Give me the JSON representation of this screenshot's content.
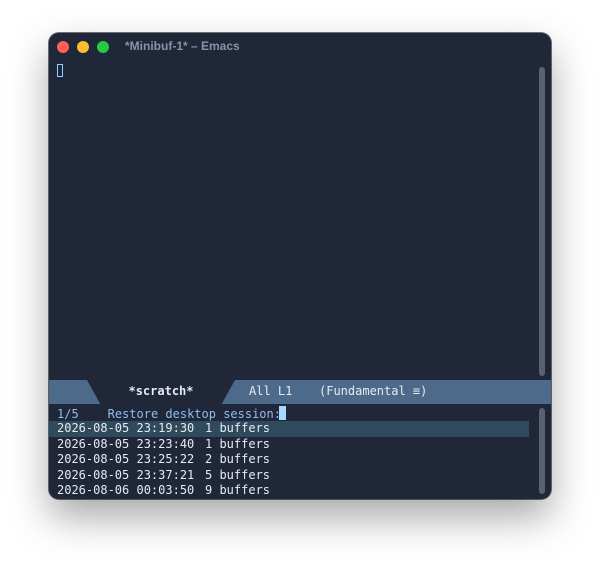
{
  "window": {
    "title": "*Minibuf-1* – Emacs"
  },
  "modeline": {
    "buffer_name": "*scratch*",
    "position": "All L1",
    "mode": "(Fundamental ≡)"
  },
  "minibuffer": {
    "counter": "1/5",
    "prompt": "Restore desktop session:",
    "candidates": [
      {
        "datetime": "2026-08-05 23:19:30",
        "buffers": "1 buffers"
      },
      {
        "datetime": "2026-08-05 23:23:40",
        "buffers": "1 buffers"
      },
      {
        "datetime": "2026-08-05 23:25:22",
        "buffers": "2 buffers"
      },
      {
        "datetime": "2026-08-05 23:37:21",
        "buffers": "5 buffers"
      },
      {
        "datetime": "2026-08-06 00:03:50",
        "buffers": "9 buffers"
      }
    ]
  },
  "colors": {
    "background": "#1f2738",
    "modeline": "#4d6a8a",
    "selection": "#2f4a5c",
    "prompt": "#8fbdf0",
    "cursor": "#a8d8ff"
  }
}
